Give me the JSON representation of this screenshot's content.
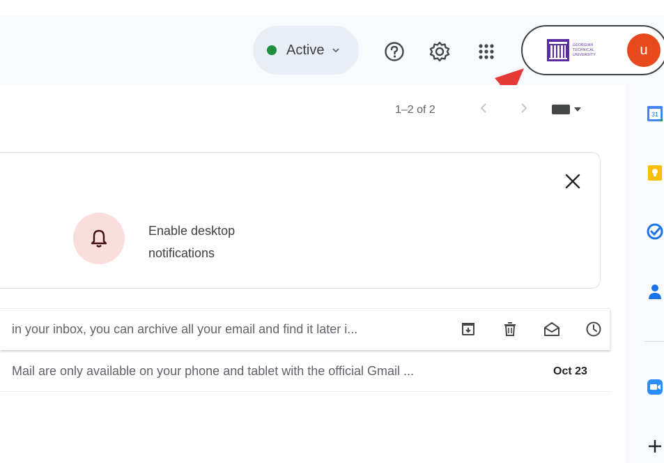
{
  "header": {
    "status": {
      "label": "Active",
      "color": "#1e8e3e"
    },
    "icons": [
      "help-icon",
      "settings-icon",
      "apps-grid-icon"
    ],
    "account": {
      "org_logo_lines": [
        "GEORGIAN",
        "TECHNICAL",
        "UNIVERSITY"
      ],
      "avatar_letter": "u",
      "avatar_color": "#e8491d"
    }
  },
  "toolbar": {
    "pagination": "1–2 of 2",
    "prev_icon": "chevron-left-icon",
    "next_icon": "chevron-right-icon",
    "input_tools_icon": "keyboard-icon"
  },
  "notification_card": {
    "line1": "Enable desktop",
    "line2": "notifications",
    "icon": "bell-icon",
    "close_icon": "close-icon"
  },
  "emails": [
    {
      "snippet": "in your inbox, you can archive all your email and find it later i...",
      "actions": [
        "archive-icon",
        "delete-icon",
        "mark-read-icon",
        "snooze-icon"
      ]
    },
    {
      "snippet": "Mail are only available on your phone and tablet with the official Gmail ...",
      "date": "Oct 23"
    }
  ],
  "side_panel": {
    "icons": [
      "calendar-icon",
      "keep-icon",
      "tasks-icon",
      "contacts-icon",
      "zoom-icon",
      "add-icon"
    ],
    "calendar_day": "31"
  },
  "annotation": {
    "arrow_color": "#e53935"
  }
}
